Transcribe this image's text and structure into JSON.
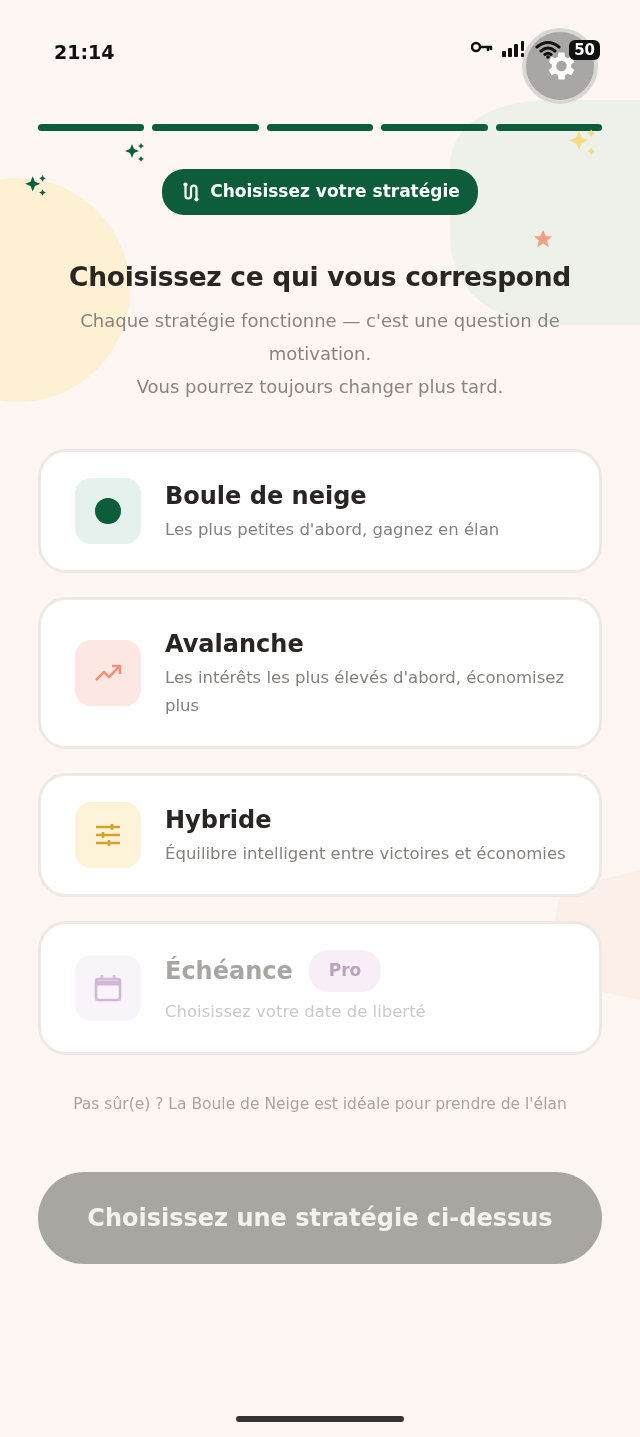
{
  "status_bar": {
    "time": "21:14",
    "battery": "50"
  },
  "progress": {
    "steps": [
      {
        "done": true
      },
      {
        "done": true
      },
      {
        "done": true
      },
      {
        "done": true
      },
      {
        "done": true
      }
    ]
  },
  "step_pill": {
    "label": "Choisissez votre stratégie"
  },
  "heading": "Choisissez ce qui vous correspond",
  "subtitle": [
    "Chaque stratégie fonctionne — c'est une question de motivation.",
    "Vous pourrez toujours changer plus tard."
  ],
  "options": [
    {
      "kind": "dot",
      "title": "Boule de neige",
      "description": "Les plus petites d'abord, gagnez en élan",
      "selected": false,
      "disabled": false
    },
    {
      "kind": "trend",
      "title": "Avalanche",
      "description": "Les intérêts les plus élevés d'abord, économisez plus",
      "selected": false,
      "disabled": false
    },
    {
      "kind": "sliders",
      "title": "Hybride",
      "description": "Équilibre intelligent entre victoires et économies",
      "selected": false,
      "disabled": false
    },
    {
      "kind": "calendar",
      "title": "Échéance",
      "badge": "Pro",
      "description": "Choisissez votre date de liberté",
      "selected": false,
      "disabled": true
    }
  ],
  "hint": "Pas sûr(e) ? La Boule de Neige est idéale pour prendre de l'élan",
  "continue_button": {
    "label": "Choisissez une stratégie ci-dessus",
    "disabled": true
  }
}
